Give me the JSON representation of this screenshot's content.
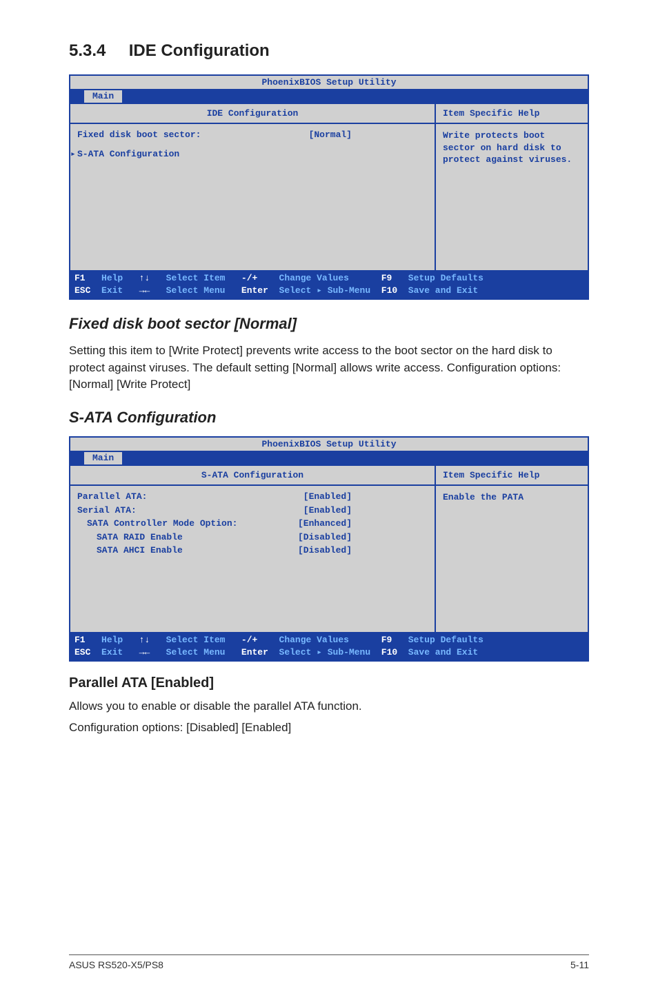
{
  "section": {
    "number": "5.3.4",
    "title": "IDE Configuration"
  },
  "bios1": {
    "utility_title": "PhoenixBIOS Setup Utility",
    "tab": "Main",
    "panel_title": "IDE Configuration",
    "help_title": "Item Specific Help",
    "rows": {
      "fixed_disk_label": "Fixed disk boot sector:",
      "fixed_disk_value": "[Normal]",
      "sata_config_label": "S-ATA Configuration"
    },
    "arrow": "▸",
    "help_body": "Write protects boot sector on hard disk to protect against viruses.",
    "footer": {
      "line1": {
        "f1": "F1",
        "help": "Help",
        "ud": "↑↓",
        "select_item": "Select Item",
        "pm": "-/+",
        "change": "Change Values",
        "f9": "F9",
        "defaults": "Setup Defaults"
      },
      "line2": {
        "esc": "ESC",
        "exit": "Exit",
        "lr": "→←",
        "select_menu": "Select Menu",
        "enter": "Enter",
        "submenu": "Select ▸ Sub-Menu",
        "f10": "F10",
        "save": "Save and Exit"
      }
    }
  },
  "fixed_disk_heading": "Fixed disk boot sector [Normal]",
  "fixed_disk_text": "Setting this item to [Write Protect] prevents write access to the boot sector on the hard disk to protect against viruses. The default setting [Normal] allows write access. Configuration options: [Normal] [Write Protect]",
  "sata_heading": "S-ATA Configuration",
  "bios2": {
    "utility_title": "PhoenixBIOS Setup Utility",
    "tab": "Main",
    "panel_title": "S-ATA Configuration",
    "help_title": "Item Specific Help",
    "rows": {
      "parallel_l": "Parallel ATA:",
      "parallel_v": "[Enabled]",
      "serial_l": "Serial ATA:",
      "serial_v": "[Enabled]",
      "mode_l": "SATA Controller Mode Option:",
      "mode_v": "[Enhanced]",
      "raid_l": "SATA RAID Enable",
      "raid_v": "[Disabled]",
      "ahci_l": "SATA AHCI Enable",
      "ahci_v": "[Disabled]"
    },
    "help_body": "Enable the PATA",
    "footer": {
      "line1": {
        "f1": "F1",
        "help": "Help",
        "ud": "↑↓",
        "select_item": "Select Item",
        "pm": "-/+",
        "change": "Change Values",
        "f9": "F9",
        "defaults": "Setup Defaults"
      },
      "line2": {
        "esc": "ESC",
        "exit": "Exit",
        "lr": "→←",
        "select_menu": "Select Menu",
        "enter": "Enter",
        "submenu": "Select ▸ Sub-Menu",
        "f10": "F10",
        "save": "Save and Exit"
      }
    }
  },
  "parallel_heading": "Parallel ATA [Enabled]",
  "parallel_text1": "Allows you to enable or disable the parallel ATA function.",
  "parallel_text2": "Configuration options: [Disabled] [Enabled]",
  "footer": {
    "left": "ASUS RS520-X5/PS8",
    "right": "5-11"
  }
}
